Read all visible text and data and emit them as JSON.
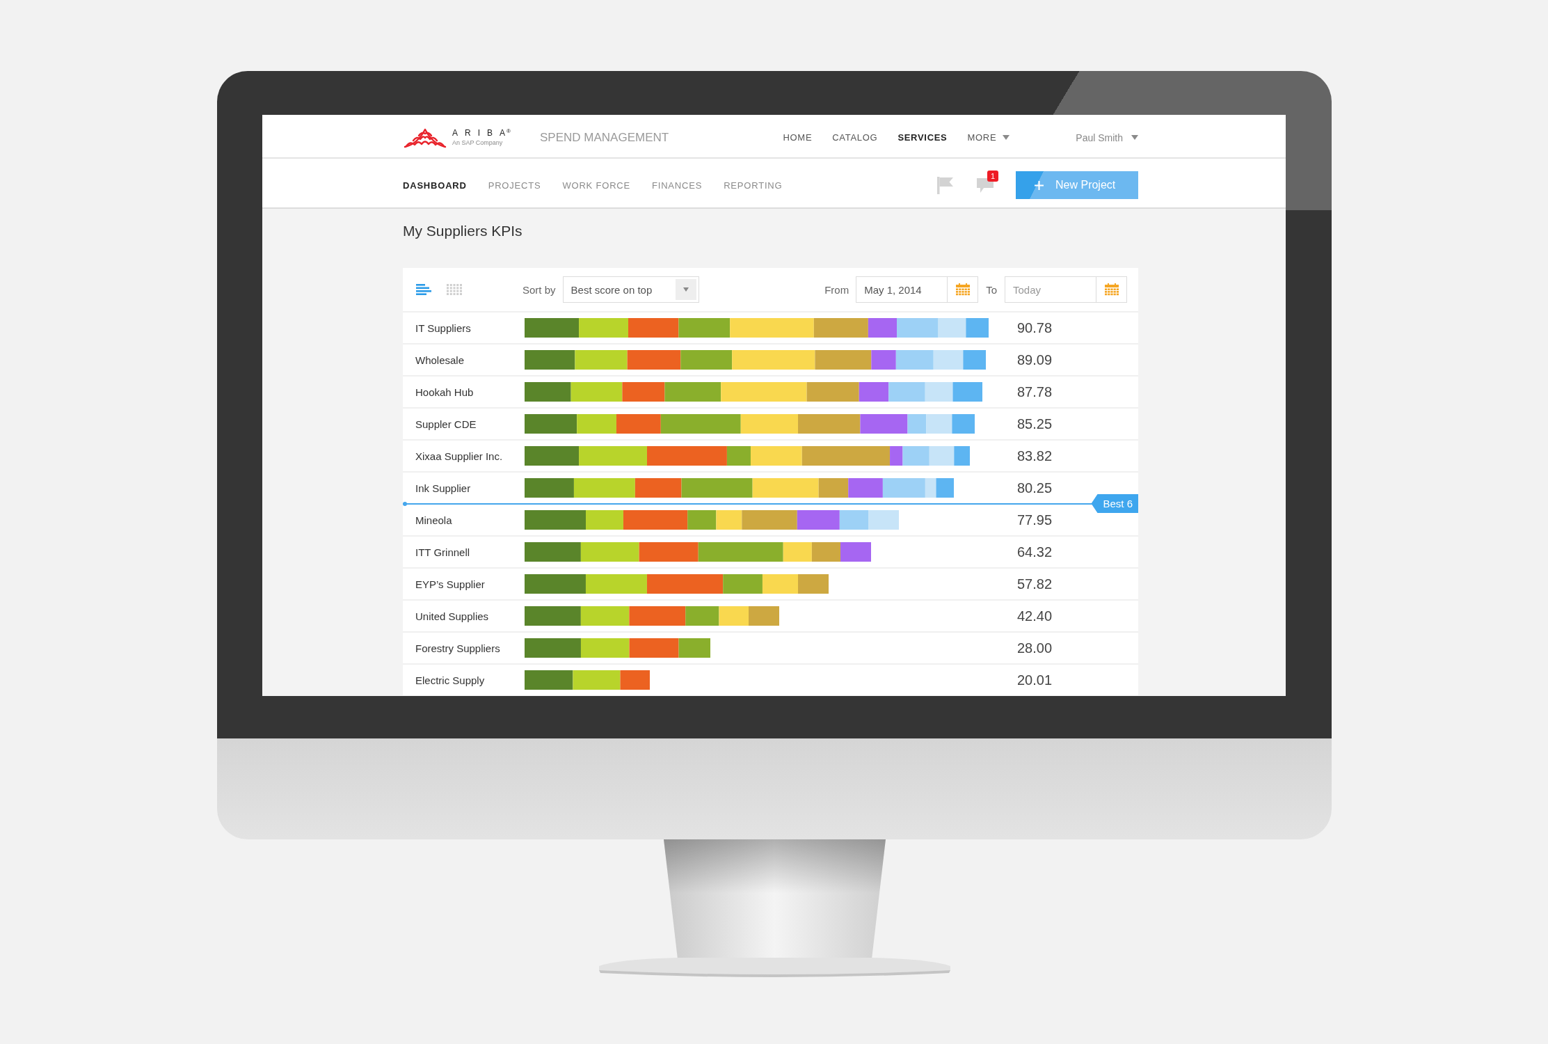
{
  "header": {
    "logo": {
      "wordmark": "ARIBA$^{®}$",
      "tagline": "An SAP Company"
    },
    "product": "SPEND MANAGEMENT",
    "nav": [
      {
        "label": "HOME",
        "selected": false,
        "dropdown": false
      },
      {
        "label": "CATALOG",
        "selected": false,
        "dropdown": false
      },
      {
        "label": "SERVICES",
        "selected": true,
        "dropdown": false
      },
      {
        "label": "MORE",
        "selected": false,
        "dropdown": true
      }
    ],
    "user": {
      "name": "Paul Smith"
    }
  },
  "subnav": {
    "tabs": [
      {
        "label": "DASHBOARD",
        "selected": true
      },
      {
        "label": "PROJECTS",
        "selected": false
      },
      {
        "label": "WORK FORCE",
        "selected": false
      },
      {
        "label": "FINANCES",
        "selected": false
      },
      {
        "label": "REPORTING",
        "selected": false
      }
    ],
    "messages": {
      "badge": "1"
    },
    "new_project_button": {
      "label": "New Project"
    }
  },
  "page_title": "My Suppliers KPIs",
  "toolbar": {
    "views": [
      {
        "kind": "bars",
        "selected": true
      },
      {
        "kind": "grid",
        "selected": false
      }
    ],
    "sort": {
      "label": "Sort by",
      "value": "Best score on top"
    },
    "from": {
      "label": "From",
      "value": "May 1, 2014"
    },
    "to": {
      "label": "To",
      "placeholder": "Today"
    }
  },
  "kpi_list": {
    "rows": [
      {
        "kind": "supplier",
        "name": "IT Suppliers",
        "score": "90.78"
      },
      {
        "kind": "supplier",
        "name": "Wholesale",
        "score": "89.09"
      },
      {
        "kind": "supplier",
        "name": "Hookah Hub",
        "score": "87.78"
      },
      {
        "kind": "supplier",
        "name": "Suppler CDE",
        "score": "85.25"
      },
      {
        "kind": "supplier",
        "name": "Xixaa Supplier Inc.",
        "score": "83.82"
      },
      {
        "kind": "supplier",
        "name": "Ink Supplier",
        "score": "80.25"
      },
      {
        "kind": "cutoff",
        "label": "Best 6"
      },
      {
        "kind": "supplier",
        "name": "Mineola",
        "score": "77.95"
      },
      {
        "kind": "supplier",
        "name": "ITT Grinnell",
        "score": "64.32"
      },
      {
        "kind": "supplier",
        "name": "EYP’s Supplier",
        "score": "57.82"
      },
      {
        "kind": "supplier",
        "name": "United Supplies",
        "score": "42.40"
      },
      {
        "kind": "supplier",
        "name": "Forestry Suppliers",
        "score": "28.00"
      },
      {
        "kind": "supplier",
        "name": "Electric Supply",
        "score": "20.01"
      }
    ]
  }
}
